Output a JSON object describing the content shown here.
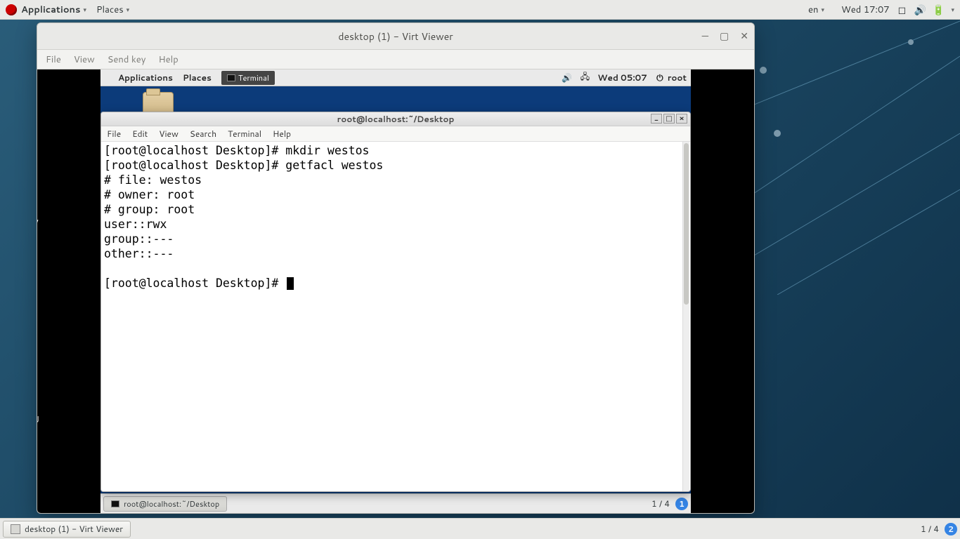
{
  "host": {
    "topbar": {
      "applications": "Applications",
      "places": "Places",
      "lang": "en",
      "clock": "Wed 17:07"
    },
    "taskbar": {
      "task_label": "desktop (1) - Virt Viewer",
      "workspace": "1 / 4",
      "badge": "2"
    }
  },
  "virt": {
    "title": "desktop (1) - Virt Viewer",
    "menus": {
      "file": "File",
      "view": "View",
      "sendkey": "Send key",
      "help": "Help"
    }
  },
  "guest": {
    "topbar": {
      "applications": "Applications",
      "places": "Places",
      "task_terminal": "Terminal",
      "clock": "Wed 05:07",
      "user": "root"
    },
    "taskbar": {
      "task_label": "root@localhost:~/Desktop",
      "workspace": "1 / 4",
      "badge": "1"
    },
    "left_letter1": "V",
    "left_letter2": "U"
  },
  "terminal": {
    "title": "root@localhost:~/Desktop",
    "menus": {
      "file": "File",
      "edit": "Edit",
      "view": "View",
      "search": "Search",
      "terminal": "Terminal",
      "help": "Help"
    },
    "lines": [
      "[root@localhost Desktop]# mkdir westos",
      "[root@localhost Desktop]# getfacl westos",
      "# file: westos",
      "# owner: root",
      "# group: root",
      "user::rwx",
      "group::---",
      "other::---",
      "",
      "[root@localhost Desktop]# "
    ]
  }
}
